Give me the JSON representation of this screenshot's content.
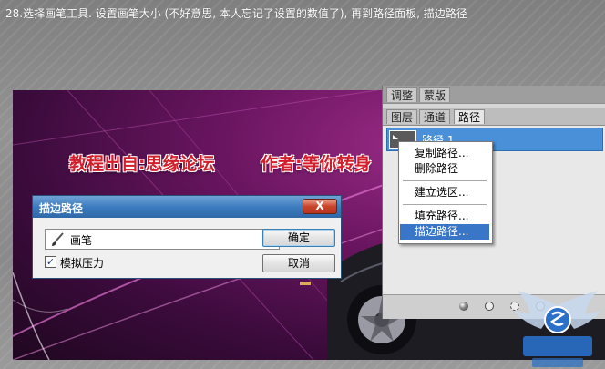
{
  "caption": "28.选择画笔工具. 设置画笔大小 (不好意思, 本人忘记了设置的数值了), 再到路径面板, 描边路径",
  "canvas": {
    "banner_left": "教程出自:思缘论坛",
    "banner_right": "作者:等你转身"
  },
  "panel": {
    "top_tabs": [
      "调整",
      "蒙版"
    ],
    "tabs": [
      "图层",
      "通道",
      "路径"
    ],
    "active_tab": "路径",
    "path_item": "路径 1"
  },
  "context_menu": {
    "items": [
      "复制路径...",
      "删除路径",
      "建立选区...",
      "填充路径...",
      "描边路径..."
    ],
    "highlighted": "描边路径..."
  },
  "dialog": {
    "title": "描边路径",
    "close_label": "X",
    "tool_value": "画笔",
    "checkbox_label": "模拟压力",
    "checkbox_checked": true,
    "checkbox_mark": "✓",
    "ok_label": "确定",
    "cancel_label": "取消"
  },
  "colors": {
    "banner_text": "#d21f2b",
    "menu_highlight": "#3a76c8",
    "dialog_title": "#3d7cc0",
    "path_selected": "#4a90d8"
  }
}
